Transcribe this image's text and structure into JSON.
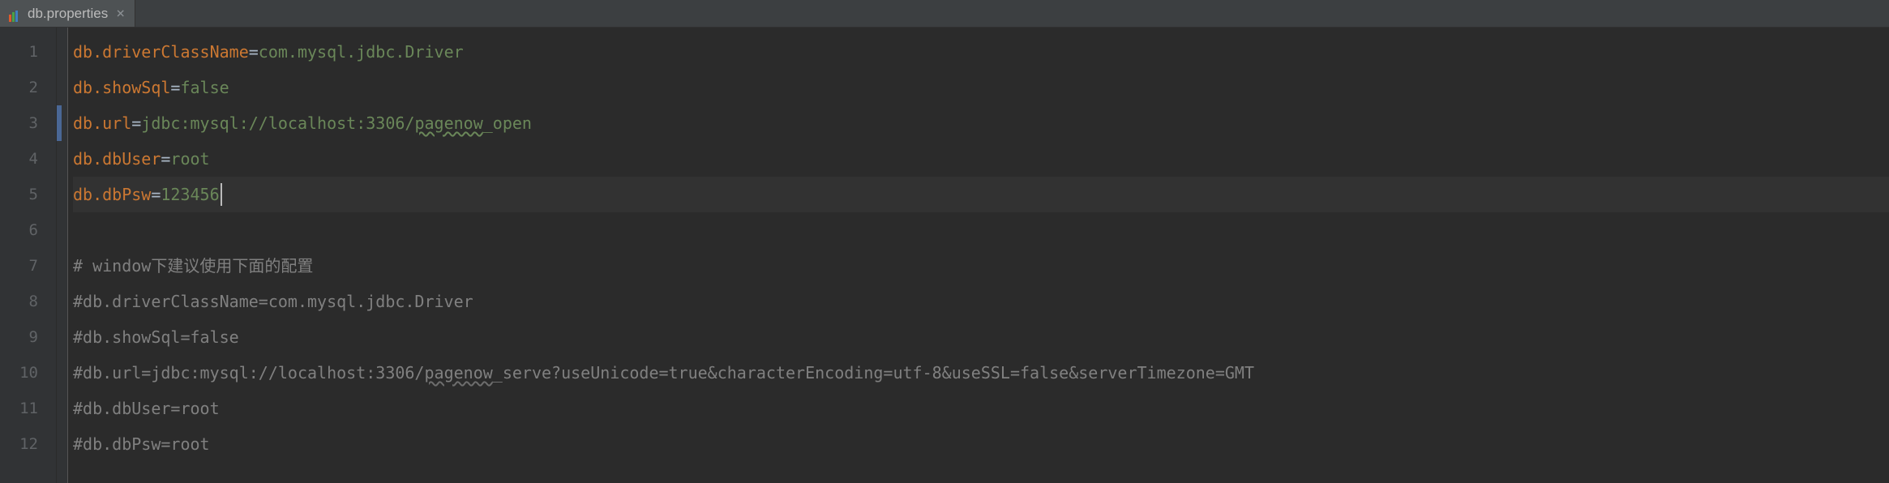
{
  "tab": {
    "filename": "db.properties",
    "close_glyph": "×"
  },
  "gutter": {
    "numbers": [
      "1",
      "2",
      "3",
      "4",
      "5",
      "6",
      "7",
      "8",
      "9",
      "10",
      "11",
      "12"
    ]
  },
  "change_marks_at": [
    3
  ],
  "current_line_index": 5,
  "lines": [
    {
      "segments": [
        {
          "cls": "tok-key",
          "text": "db.driverClassName"
        },
        {
          "cls": "tok-eq",
          "text": "="
        },
        {
          "cls": "tok-val",
          "text": "com.mysql.jdbc.Driver"
        }
      ]
    },
    {
      "segments": [
        {
          "cls": "tok-key",
          "text": "db.showSql"
        },
        {
          "cls": "tok-eq",
          "text": "="
        },
        {
          "cls": "tok-val",
          "text": "false"
        }
      ]
    },
    {
      "segments": [
        {
          "cls": "tok-key",
          "text": "db.url"
        },
        {
          "cls": "tok-eq",
          "text": "="
        },
        {
          "cls": "tok-val",
          "text": "jdbc:mysql://localhost:3306/"
        },
        {
          "cls": "tok-val spell",
          "text": "pagenow"
        },
        {
          "cls": "tok-val",
          "text": "_open"
        }
      ]
    },
    {
      "segments": [
        {
          "cls": "tok-key",
          "text": "db.dbUser"
        },
        {
          "cls": "tok-eq",
          "text": "="
        },
        {
          "cls": "tok-val",
          "text": "root"
        }
      ]
    },
    {
      "segments": [
        {
          "cls": "tok-key",
          "text": "db.dbPsw"
        },
        {
          "cls": "tok-eq",
          "text": "="
        },
        {
          "cls": "tok-val",
          "text": "123456"
        }
      ],
      "caret_after": true
    },
    {
      "segments": []
    },
    {
      "segments": [
        {
          "cls": "tok-comment",
          "text": "# window下建议使用下面的配置"
        }
      ]
    },
    {
      "segments": [
        {
          "cls": "tok-comment",
          "text": "#db.driverClassName=com.mysql.jdbc.Driver"
        }
      ]
    },
    {
      "segments": [
        {
          "cls": "tok-comment",
          "text": "#db.showSql=false"
        }
      ]
    },
    {
      "segments": [
        {
          "cls": "tok-comment",
          "text": "#db.url=jdbc:mysql://localhost:3306/"
        },
        {
          "cls": "tok-comment spell-grey",
          "text": "pagenow"
        },
        {
          "cls": "tok-comment",
          "text": "_serve?useUnicode=true&characterEncoding=utf-8&useSSL=false&serverTimezone=GMT"
        }
      ]
    },
    {
      "segments": [
        {
          "cls": "tok-comment",
          "text": "#db.dbUser=root"
        }
      ]
    },
    {
      "segments": [
        {
          "cls": "tok-comment",
          "text": "#db.dbPsw=root"
        }
      ]
    }
  ]
}
